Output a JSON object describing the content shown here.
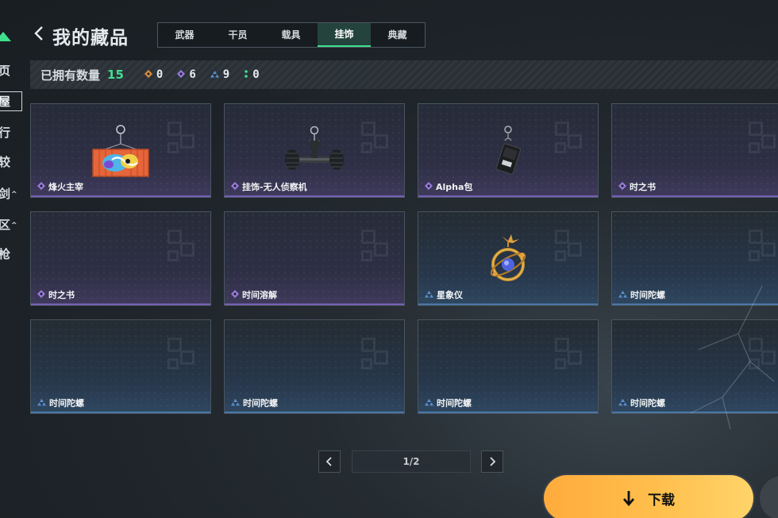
{
  "sidebar": {
    "items": [
      {
        "label": "页",
        "caret": false,
        "active": false
      },
      {
        "label": "屋",
        "caret": false,
        "active": true
      },
      {
        "label": "行",
        "caret": false,
        "active": false
      },
      {
        "label": "较",
        "caret": false,
        "active": false
      },
      {
        "label": "剑",
        "caret": true,
        "active": false
      },
      {
        "label": "区",
        "caret": true,
        "active": false
      },
      {
        "label": "枪",
        "caret": false,
        "active": false
      }
    ]
  },
  "header": {
    "title": "我的藏品",
    "tabs": [
      "武器",
      "干员",
      "载具",
      "挂饰",
      "典藏"
    ],
    "active_tab": "挂饰"
  },
  "owned": {
    "label": "已拥有数量",
    "total": "15",
    "counts": [
      {
        "icon": "orange-diamond-icon",
        "value": "0",
        "color": "#e08a3c"
      },
      {
        "icon": "purple-diamond-icon",
        "value": "6",
        "color": "#9a7ae0"
      },
      {
        "icon": "blue-diamond-icon",
        "value": "9",
        "color": "#5b8fd0"
      },
      {
        "icon": "green-dots-icon",
        "value": "0",
        "color": "#3fe08d"
      }
    ]
  },
  "items": [
    {
      "name": "烽火主宰",
      "rarity": "purple",
      "art": "container"
    },
    {
      "name": "挂饰-无人侦察机",
      "rarity": "purple",
      "art": "drone"
    },
    {
      "name": "Alpha包",
      "rarity": "purple",
      "art": "pack"
    },
    {
      "name": "时之书",
      "rarity": "purple",
      "art": ""
    },
    {
      "name": "时之书",
      "rarity": "purple",
      "art": ""
    },
    {
      "name": "时间溶解",
      "rarity": "purple",
      "art": ""
    },
    {
      "name": "星象仪",
      "rarity": "blue",
      "art": "astrolabe"
    },
    {
      "name": "时间陀螺",
      "rarity": "blue",
      "art": ""
    },
    {
      "name": "时间陀螺",
      "rarity": "blue",
      "art": ""
    },
    {
      "name": "时间陀螺",
      "rarity": "blue",
      "art": ""
    },
    {
      "name": "时间陀螺",
      "rarity": "blue",
      "art": ""
    },
    {
      "name": "时间陀螺",
      "rarity": "blue",
      "art": ""
    }
  ],
  "pagination": {
    "label": "1/2"
  },
  "download": {
    "label": "下载"
  },
  "colors": {
    "accent": "#3fe08d",
    "purple": "#7860b8",
    "blue": "#4a78a8",
    "download": "#ffb443"
  }
}
